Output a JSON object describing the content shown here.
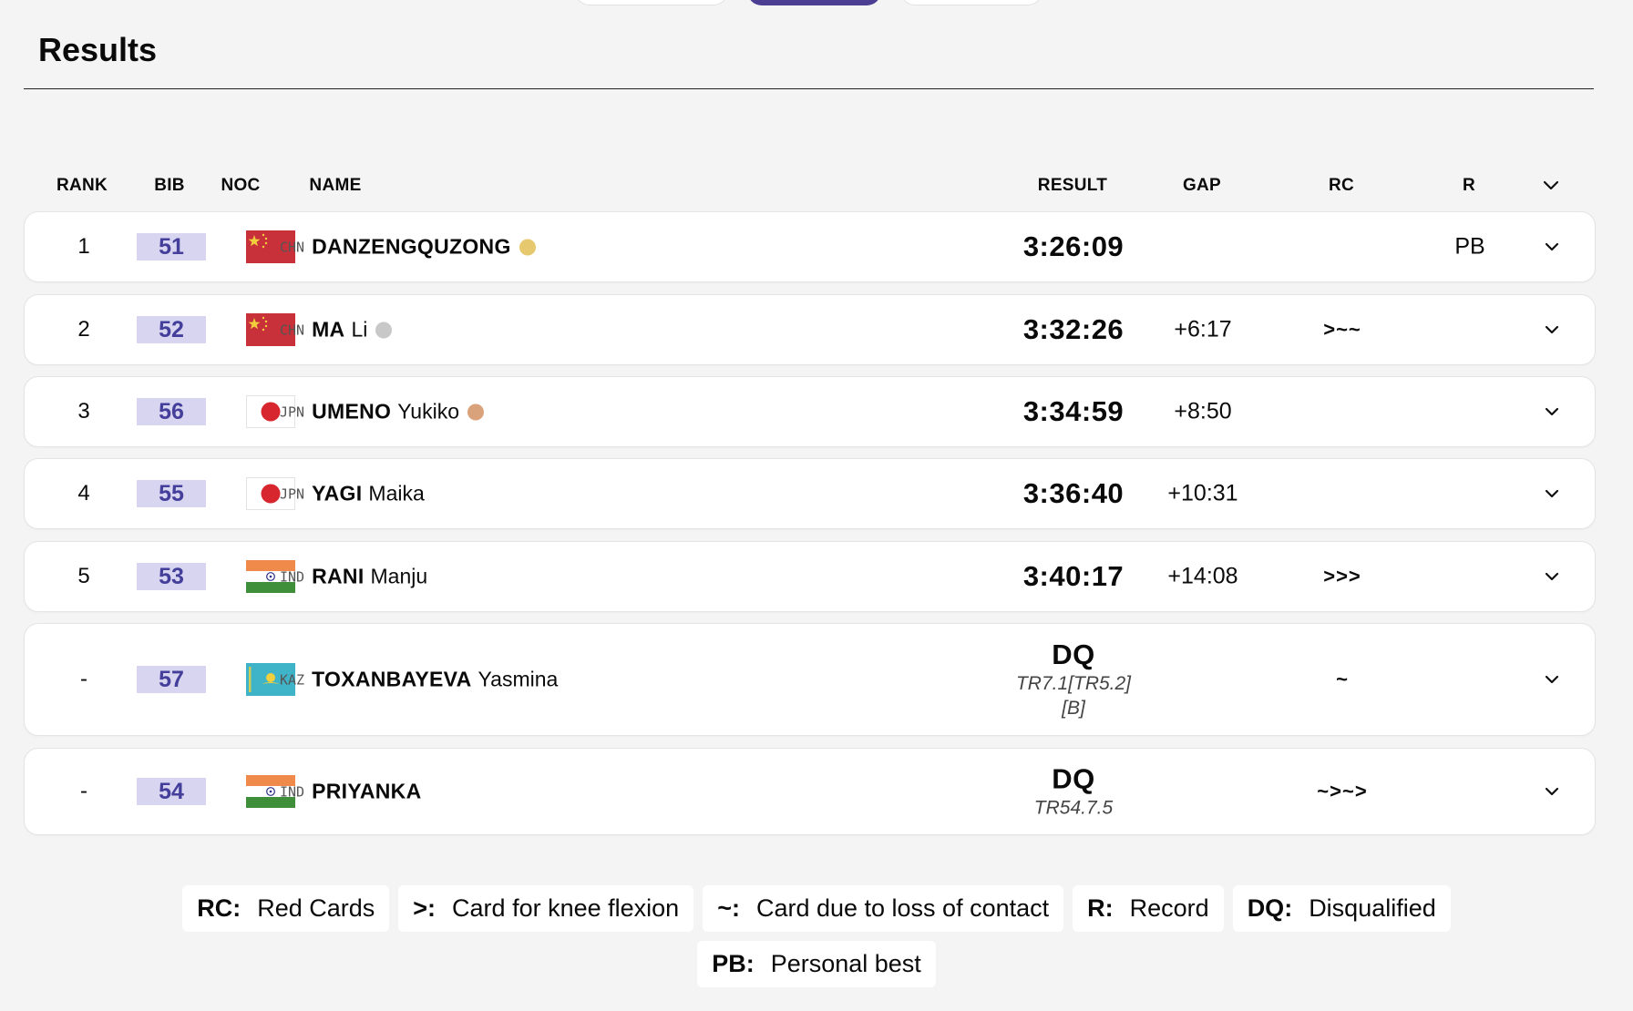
{
  "page_title": "Results",
  "columns": {
    "rank": "RANK",
    "bib": "BIB",
    "noc": "NOC",
    "name": "NAME",
    "result": "RESULT",
    "gap": "GAP",
    "rc": "RC",
    "record": "R"
  },
  "colors": {
    "accent": "#4b3e93",
    "bib_bg": "#d8d5f0",
    "bib_text": "#433f9a",
    "gold": "#e6c86e",
    "silver": "#c8c8c8",
    "bronze": "#d9a27a"
  },
  "rows": [
    {
      "rank": "1",
      "bib": "51",
      "noc": "CHN",
      "surname": "DANZENGQUZONG",
      "given": "",
      "medal": "gold",
      "flag": "china-flag",
      "result": "3:26:09",
      "result_sub": "",
      "gap": "",
      "rc": "",
      "record": "PB"
    },
    {
      "rank": "2",
      "bib": "52",
      "noc": "CHN",
      "surname": "MA",
      "given": "Li",
      "medal": "silver",
      "flag": "china-flag",
      "result": "3:32:26",
      "result_sub": "",
      "gap": "+6:17",
      "rc": ">~~",
      "record": ""
    },
    {
      "rank": "3",
      "bib": "56",
      "noc": "JPN",
      "surname": "UMENO",
      "given": "Yukiko",
      "medal": "bronze",
      "flag": "japan-flag",
      "result": "3:34:59",
      "result_sub": "",
      "gap": "+8:50",
      "rc": "",
      "record": ""
    },
    {
      "rank": "4",
      "bib": "55",
      "noc": "JPN",
      "surname": "YAGI",
      "given": "Maika",
      "medal": "",
      "flag": "japan-flag",
      "result": "3:36:40",
      "result_sub": "",
      "gap": "+10:31",
      "rc": "",
      "record": ""
    },
    {
      "rank": "5",
      "bib": "53",
      "noc": "IND",
      "surname": "RANI",
      "given": "Manju",
      "medal": "",
      "flag": "india-flag",
      "result": "3:40:17",
      "result_sub": "",
      "gap": "+14:08",
      "rc": ">>>",
      "record": ""
    },
    {
      "rank": "-",
      "bib": "57",
      "noc": "KAZ",
      "surname": "TOXANBAYEVA",
      "given": "Yasmina",
      "medal": "",
      "flag": "kazakhstan-flag",
      "result": "DQ",
      "result_sub": "TR7.1[TR5.2] [B]",
      "gap": "",
      "rc": "~",
      "record": ""
    },
    {
      "rank": "-",
      "bib": "54",
      "noc": "IND",
      "surname": "PRIYANKA",
      "given": "",
      "medal": "",
      "flag": "india-flag",
      "result": "DQ",
      "result_sub": "TR54.7.5",
      "gap": "",
      "rc": "~>~>",
      "record": ""
    }
  ],
  "legend": [
    {
      "key": "RC:",
      "label": "Red Cards"
    },
    {
      "key": ">:",
      "label": "Card for knee flexion"
    },
    {
      "key": "~:",
      "label": "Card due to loss of contact"
    },
    {
      "key": "R:",
      "label": "Record"
    },
    {
      "key": "DQ:",
      "label": "Disqualified"
    },
    {
      "key": "PB:",
      "label": "Personal best"
    }
  ]
}
